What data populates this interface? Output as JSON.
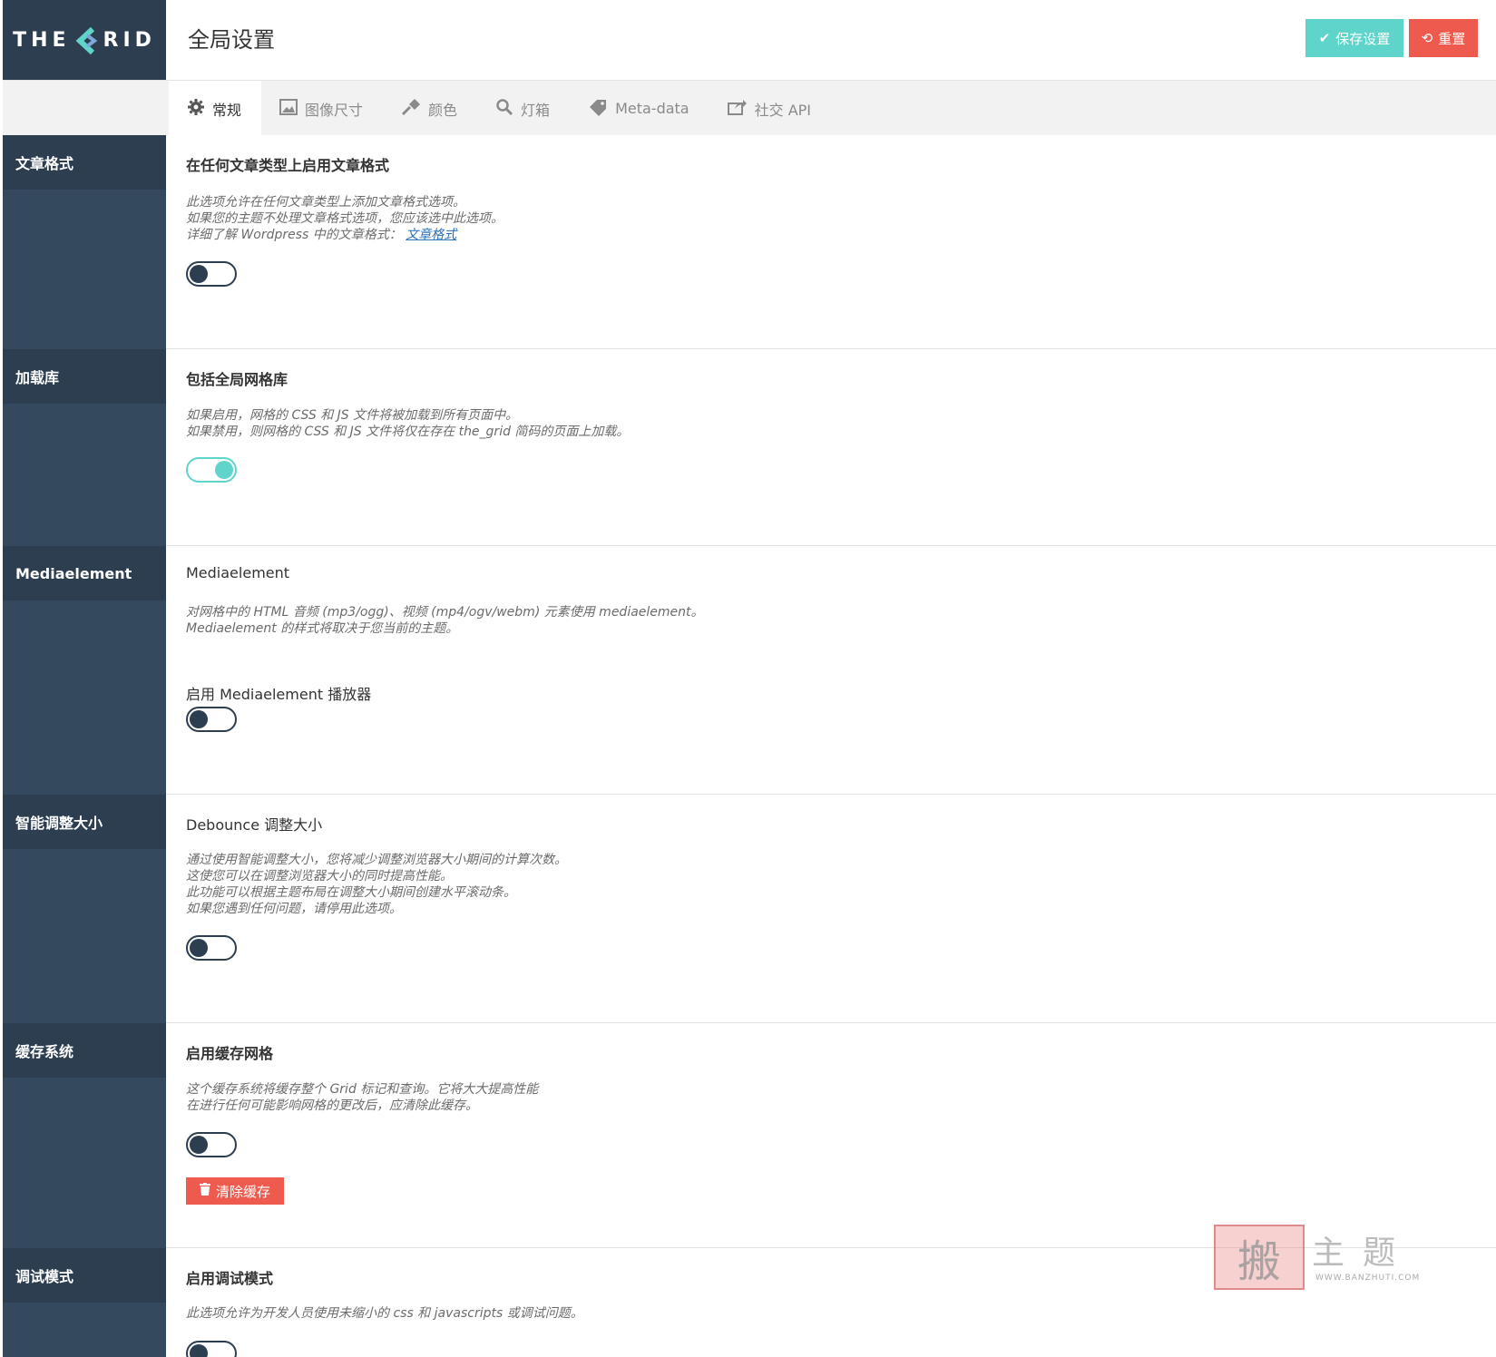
{
  "header": {
    "logo_left": "THE",
    "logo_right": "RID",
    "title": "全局设置",
    "save_label": "保存设置",
    "reset_label": "重置"
  },
  "tabs": [
    {
      "label": "常规",
      "icon": "gear-icon",
      "active": true
    },
    {
      "label": "图像尺寸",
      "icon": "image-icon"
    },
    {
      "label": "颜色",
      "icon": "brush-icon"
    },
    {
      "label": "灯箱",
      "icon": "search-icon"
    },
    {
      "label": "Meta-data",
      "icon": "tag-icon"
    },
    {
      "label": "社交 API",
      "icon": "share-icon"
    }
  ],
  "sections": {
    "post_format": {
      "side": "文章格式",
      "title": "在任何文章类型上启用文章格式",
      "desc1": "此选项允许在任何文章类型上添加文章格式选项。",
      "desc2": "如果您的主题不处理文章格式选项，您应该选中此选项。",
      "desc3": "详细了解 Wordpress 中的文章格式：",
      "link": "文章格式",
      "enabled": false
    },
    "load_library": {
      "side": "加载库",
      "title": "包括全局网格库",
      "desc1": "如果启用，网格的 CSS 和 JS 文件将被加载到所有页面中。",
      "desc2": "如果禁用，则网格的 CSS 和 JS 文件将仅在存在 the_grid 简码的页面上加载。",
      "enabled": true
    },
    "mediaelement": {
      "side": "Mediaelement",
      "title": "Mediaelement",
      "desc1": "对网格中的 HTML 音频 (mp3/ogg)、视频 (mp4/ogv/webm) 元素使用 mediaelement。",
      "desc2": "Mediaelement 的样式将取决于您当前的主题。",
      "sub_title": "启用 Mediaelement 播放器",
      "enabled": false
    },
    "smart_resize": {
      "side": "智能调整大小",
      "title": "Debounce 调整大小",
      "desc1": "通过使用智能调整大小，您将减少调整浏览器大小期间的计算次数。",
      "desc2": "这使您可以在调整浏览器大小的同时提高性能。",
      "desc3": "此功能可以根据主题布局在调整大小期间创建水平滚动条。",
      "desc4": "如果您遇到任何问题，请停用此选项。",
      "enabled": false
    },
    "cache": {
      "side": "缓存系统",
      "title": "启用缓存网格",
      "desc1": "这个缓存系统将缓存整个 Grid 标记和查询。它将大大提高性能",
      "desc2": "在进行任何可能影响网格的更改后，应清除此缓存。",
      "clear_label": "清除缓存",
      "enabled": false
    },
    "debug": {
      "side": "调试模式",
      "title": "启用调试模式",
      "desc1": "此选项允许为开发人员使用未缩小的 css 和 javascripts 或调试问题。",
      "enabled": false
    }
  },
  "watermark": {
    "seal": "搬",
    "text": "主题",
    "url": "WWW.BANZHUTI.COM"
  },
  "colors": {
    "sidebar": "#34495e",
    "sidebar_head": "#2c3e50",
    "accent": "#5fd4cb",
    "danger": "#ee5b4e"
  }
}
